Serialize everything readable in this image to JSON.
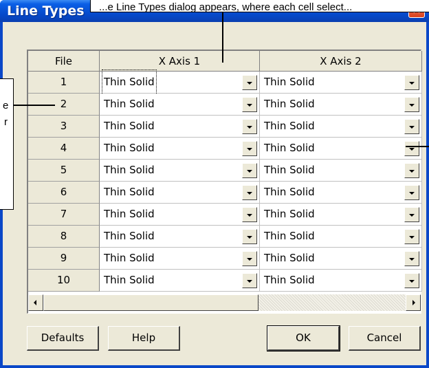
{
  "window": {
    "title": "Line Types",
    "close_glyph": "✕"
  },
  "grid": {
    "headers": {
      "file": "File",
      "col1": "X Axis 1",
      "col2": "X Axis 2"
    },
    "rows": [
      {
        "file": "1",
        "x1": "Thin Solid",
        "x2": "Thin Solid"
      },
      {
        "file": "2",
        "x1": "Thin Solid",
        "x2": "Thin Solid"
      },
      {
        "file": "3",
        "x1": "Thin Solid",
        "x2": "Thin Solid"
      },
      {
        "file": "4",
        "x1": "Thin Solid",
        "x2": "Thin Solid"
      },
      {
        "file": "5",
        "x1": "Thin Solid",
        "x2": "Thin Solid"
      },
      {
        "file": "6",
        "x1": "Thin Solid",
        "x2": "Thin Solid"
      },
      {
        "file": "7",
        "x1": "Thin Solid",
        "x2": "Thin Solid"
      },
      {
        "file": "8",
        "x1": "Thin Solid",
        "x2": "Thin Solid"
      },
      {
        "file": "9",
        "x1": "Thin Solid",
        "x2": "Thin Solid"
      },
      {
        "file": "10",
        "x1": "Thin Solid",
        "x2": "Thin Solid"
      }
    ]
  },
  "buttons": {
    "defaults": "Defaults",
    "help": "Help",
    "ok": "OK",
    "cancel": "Cancel"
  },
  "callouts": {
    "top": "...e Line Types dialog appears, where each cell select...",
    "left_line1": "e",
    "left_line2": "r"
  },
  "colors": {
    "title_bar": "#0a5fe6",
    "dialog_face": "#ece9d8",
    "close_button": "#d8401c"
  }
}
